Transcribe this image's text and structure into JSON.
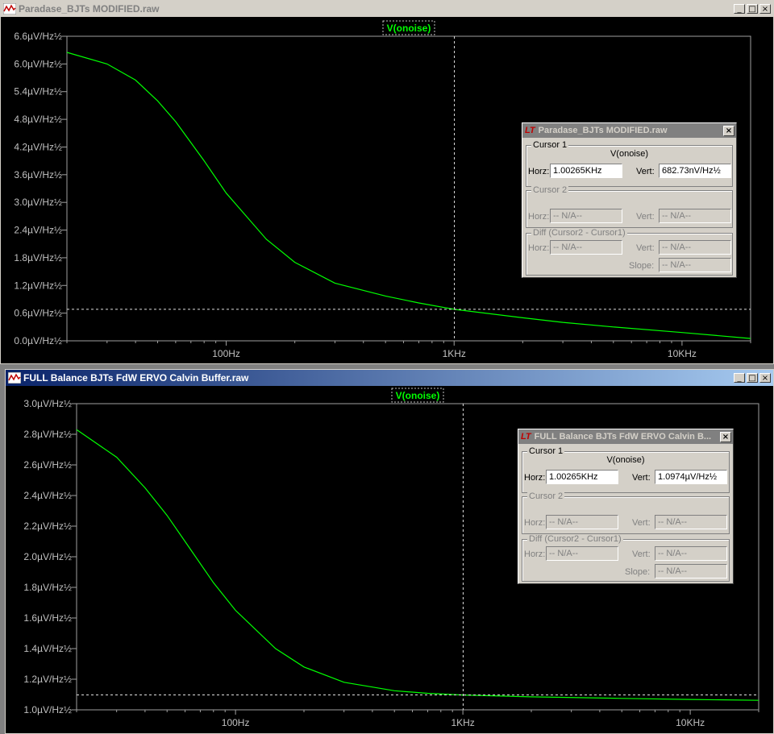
{
  "windows": [
    {
      "title": "Paradase_BJTs MODIFIED.raw",
      "state": "inactive",
      "trace_label": "V(onoise)",
      "cursor_dialog": {
        "title": "Paradase_BJTs MODIFIED.raw",
        "cursor1_caption": "Cursor 1",
        "trace": "V(onoise)",
        "horz_label": "Horz:",
        "horz_value": "1.00265KHz",
        "vert_label": "Vert:",
        "vert_value": "682.73nV/Hz½",
        "cursor2_caption": "Cursor 2",
        "cursor2_horz": "-- N/A--",
        "cursor2_vert": "-- N/A--",
        "diff_caption": "Diff (Cursor2 - Cursor1)",
        "diff_horz": "-- N/A--",
        "diff_vert": "-- N/A--",
        "slope_label": "Slope:",
        "slope_value": "-- N/A--"
      }
    },
    {
      "title": "FULL Balance BJTs FdW ERVO Calvin Buffer.raw",
      "state": "active",
      "trace_label": "V(onoise)",
      "cursor_dialog": {
        "title": "FULL Balance BJTs FdW ERVO Calvin B...",
        "cursor1_caption": "Cursor 1",
        "trace": "V(onoise)",
        "horz_label": "Horz:",
        "horz_value": "1.00265KHz",
        "vert_label": "Vert:",
        "vert_value": "1.0974µV/Hz½",
        "cursor2_caption": "Cursor 2",
        "cursor2_horz": "-- N/A--",
        "cursor2_vert": "-- N/A--",
        "diff_caption": "Diff (Cursor2 - Cursor1)",
        "diff_horz": "-- N/A--",
        "diff_vert": "-- N/A--",
        "slope_label": "Slope:",
        "slope_value": "-- N/A--"
      }
    }
  ],
  "window_buttons": {
    "minimize": "_",
    "maximize": "□",
    "close": "×"
  },
  "chart_data": [
    {
      "type": "line",
      "x_scale": "log",
      "xlim": [
        20,
        20000
      ],
      "ylim": [
        0,
        6.6
      ],
      "y_unit": "µV/Hz½",
      "grid": false,
      "x_tick_labels": [
        "100Hz",
        "1KHz",
        "10KHz"
      ],
      "x_tick_values": [
        100,
        1000,
        10000
      ],
      "y_tick_labels": [
        "6.6µV/Hz½",
        "6.0µV/Hz½",
        "5.4µV/Hz½",
        "4.8µV/Hz½",
        "4.2µV/Hz½",
        "3.6µV/Hz½",
        "3.0µV/Hz½",
        "2.4µV/Hz½",
        "1.8µV/Hz½",
        "1.2µV/Hz½",
        "0.6µV/Hz½",
        "0.0µV/Hz½"
      ],
      "y_tick_values": [
        6.6,
        6.0,
        5.4,
        4.8,
        4.2,
        3.6,
        3.0,
        2.4,
        1.8,
        1.2,
        0.6,
        0.0
      ],
      "cursor": {
        "x": 1002.65,
        "y": 0.683
      },
      "series": [
        {
          "color": "#00ff00",
          "x": [
            20,
            30,
            40,
            50,
            60,
            80,
            100,
            150,
            200,
            300,
            500,
            700,
            1000,
            2000,
            3000,
            5000,
            10000,
            20000
          ],
          "y": [
            6.25,
            6.0,
            5.65,
            5.2,
            4.75,
            3.9,
            3.2,
            2.2,
            1.7,
            1.25,
            0.97,
            0.82,
            0.683,
            0.5,
            0.4,
            0.3,
            0.18,
            0.05
          ]
        }
      ]
    },
    {
      "type": "line",
      "x_scale": "log",
      "xlim": [
        20,
        20000
      ],
      "ylim": [
        1.0,
        3.0
      ],
      "y_unit": "µV/Hz½",
      "grid": false,
      "x_tick_labels": [
        "100Hz",
        "1KHz",
        "10KHz"
      ],
      "x_tick_values": [
        100,
        1000,
        10000
      ],
      "y_tick_labels": [
        "3.0µV/Hz½",
        "2.8µV/Hz½",
        "2.6µV/Hz½",
        "2.4µV/Hz½",
        "2.2µV/Hz½",
        "2.0µV/Hz½",
        "1.8µV/Hz½",
        "1.6µV/Hz½",
        "1.4µV/Hz½",
        "1.2µV/Hz½",
        "1.0µV/Hz½"
      ],
      "y_tick_values": [
        3.0,
        2.8,
        2.6,
        2.4,
        2.2,
        2.0,
        1.8,
        1.6,
        1.4,
        1.2,
        1.0
      ],
      "cursor": {
        "x": 1002.65,
        "y": 1.0974
      },
      "series": [
        {
          "color": "#00ff00",
          "x": [
            20,
            30,
            40,
            50,
            60,
            80,
            100,
            150,
            200,
            300,
            500,
            700,
            1000,
            2000,
            5000,
            10000,
            20000
          ],
          "y": [
            2.83,
            2.65,
            2.45,
            2.27,
            2.1,
            1.83,
            1.65,
            1.4,
            1.28,
            1.18,
            1.125,
            1.108,
            1.097,
            1.085,
            1.075,
            1.068,
            1.062
          ]
        }
      ]
    }
  ]
}
